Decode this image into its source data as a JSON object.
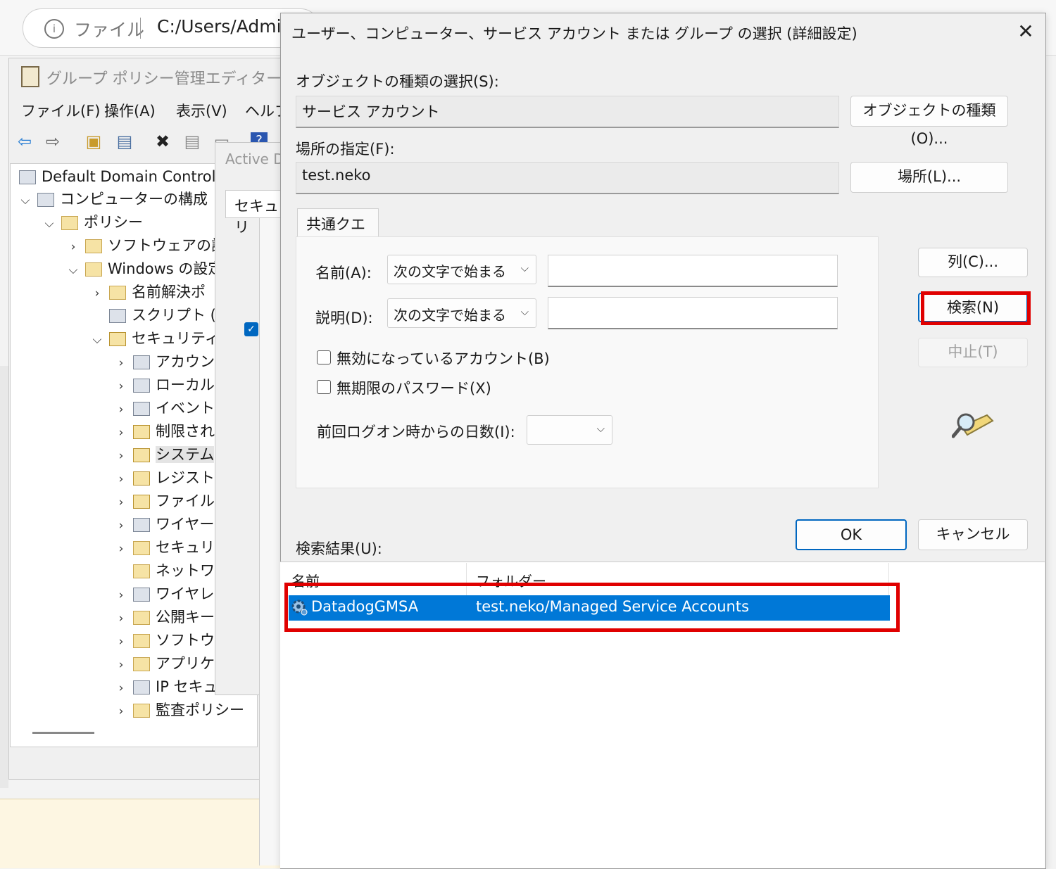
{
  "browser": {
    "protocol_label": "ファイル",
    "url": "C:/Users/Admin"
  },
  "gpm": {
    "title": "グループ ポリシー管理エディター",
    "menu": [
      "ファイル(F)",
      "操作(A)",
      "表示(V)",
      "ヘルプ"
    ],
    "tree": [
      {
        "label": "Default Domain Controller",
        "icon": "policy-icon"
      },
      {
        "label": "コンピューターの構成",
        "icon": "computer-icon"
      },
      {
        "label": "ポリシー",
        "icon": "folder-icon"
      },
      {
        "label": "ソフトウェアの設定",
        "icon": "folder-icon"
      },
      {
        "label": "Windows の設定",
        "icon": "folder-icon"
      },
      {
        "label": "名前解決ポ",
        "icon": "folder-icon"
      },
      {
        "label": "スクリプト (ス",
        "icon": "script-icon"
      },
      {
        "label": "セキュリティの",
        "icon": "security-icon"
      },
      {
        "label": "アカウント",
        "icon": "server-icon"
      },
      {
        "label": "ローカル",
        "icon": "server-icon"
      },
      {
        "label": "イベント",
        "icon": "server-icon"
      },
      {
        "label": "制限され",
        "icon": "lock-folder-icon"
      },
      {
        "label": "システム",
        "icon": "lock-folder-icon"
      },
      {
        "label": "レジストリ",
        "icon": "lock-folder-icon"
      },
      {
        "label": "ファイル",
        "icon": "lock-folder-icon"
      },
      {
        "label": "ワイヤー",
        "icon": "network-icon"
      },
      {
        "label": "セキュリテ",
        "icon": "folder-icon"
      },
      {
        "label": "ネットワー",
        "icon": "folder-icon"
      },
      {
        "label": "ワイヤレ",
        "icon": "chart-icon"
      },
      {
        "label": "公開キー",
        "icon": "folder-icon"
      },
      {
        "label": "ソフトウェ",
        "icon": "folder-icon"
      },
      {
        "label": "アプリケー",
        "icon": "folder-icon"
      },
      {
        "label": "IP セキュ",
        "icon": "ipsec-icon"
      },
      {
        "label": "監査ポリシー",
        "icon": "folder-icon"
      }
    ]
  },
  "mid_dialog": {
    "title": "Active D",
    "tab": "セキュリ"
  },
  "dialog": {
    "title": "ユーザー、コンピューター、サービス アカウント または グループ の選択 (詳細設定)",
    "object_type_label": "オブジェクトの種類の選択(S):",
    "object_type_value": "サービス アカウント",
    "object_type_button": "オブジェクトの種類(O)...",
    "location_label": "場所の指定(F):",
    "location_value": "test.neko",
    "location_button": "場所(L)...",
    "tab_common_query": "共通クエリ",
    "name_label": "名前(A):",
    "name_mode": "次の文字で始まる",
    "desc_label": "説明(D):",
    "desc_mode": "次の文字で始まる",
    "disabled_accounts": "無効になっているアカウント(B)",
    "non_expiring_pw": "無期限のパスワード(X)",
    "days_since_logon_label": "前回ログオン時からの日数(I):",
    "columns_button": "列(C)...",
    "search_button": "検索(N)",
    "stop_button": "中止(T)",
    "ok_button": "OK",
    "cancel_button": "キャンセル",
    "results_label": "検索結果(U):",
    "results_columns": [
      "名前",
      "フォルダー"
    ],
    "results_rows": [
      {
        "name": "DatadogGMSA",
        "folder": "test.neko/Managed Service Accounts"
      }
    ]
  },
  "colors": {
    "highlight": "#e00000",
    "selection": "#0078d7",
    "accent": "#0067c0"
  }
}
